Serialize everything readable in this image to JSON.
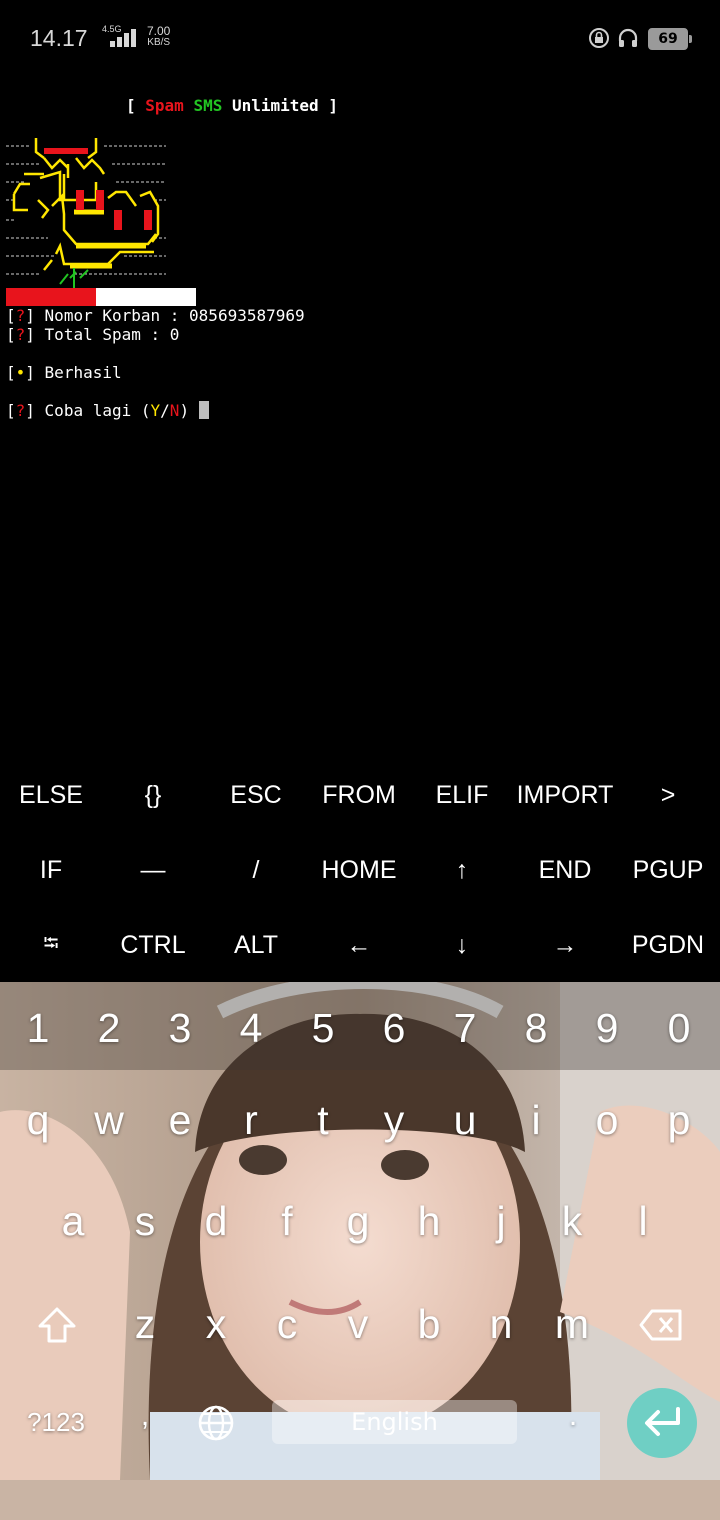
{
  "status_bar": {
    "time": "14.17",
    "network": "4.5G",
    "speed_value": "7.00",
    "speed_unit": "KB/S",
    "battery": "69"
  },
  "terminal": {
    "title_open": "[ ",
    "title_spam": "Spam",
    "title_sms": "SMS",
    "title_rest": "Unlimited ]",
    "q_mark": "?",
    "bullet": "•",
    "line1_label": "Nomor Korban : 085693587969",
    "line2_label": "Total Spam : 0",
    "line3_label": "Berhasil",
    "line4_label": "Coba lagi (",
    "line4_y": "Y",
    "line4_slash": "/",
    "line4_n": "N",
    "line4_close": ")"
  },
  "extra_keys": {
    "row1": [
      "ELSE",
      "{}",
      "ESC",
      "FROM",
      "ELIF",
      "IMPORT",
      ">"
    ],
    "row2": [
      "IF",
      "—",
      "/",
      "HOME",
      "↑",
      "END",
      "PGUP"
    ],
    "row3": [
      "⭾",
      "CTRL",
      "ALT",
      "←",
      "↓",
      "→",
      "PGDN"
    ]
  },
  "keyboard": {
    "numbers": [
      "1",
      "2",
      "3",
      "4",
      "5",
      "6",
      "7",
      "8",
      "9",
      "0"
    ],
    "row1": [
      "q",
      "w",
      "e",
      "r",
      "t",
      "y",
      "u",
      "i",
      "o",
      "p"
    ],
    "row2": [
      "a",
      "s",
      "d",
      "f",
      "g",
      "h",
      "j",
      "k",
      "l"
    ],
    "row3": [
      "z",
      "x",
      "c",
      "v",
      "b",
      "n",
      "m"
    ],
    "symbols_key": "?123",
    "comma_key": ",",
    "space_label": "English",
    "period_key": ".",
    "icons": [
      "shift-icon",
      "backspace-icon",
      "globe-icon",
      "enter-icon"
    ]
  },
  "colors": {
    "terminal_red": "#e8141c",
    "terminal_green": "#22c422",
    "terminal_yellow": "#ffe600",
    "enter_key": "#6fcfc4",
    "navbar": "#c9b4a4"
  }
}
